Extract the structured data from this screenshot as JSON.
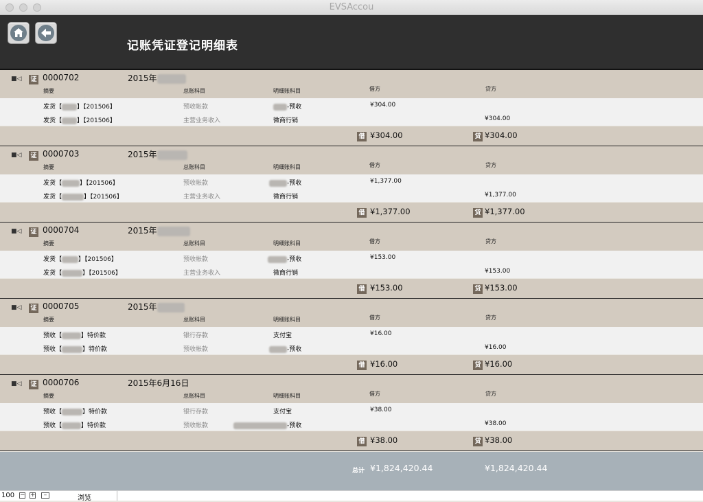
{
  "window": {
    "title": "EVSAccou"
  },
  "header": {
    "title": "记账凭证登记明细表"
  },
  "columns": {
    "summary": "摘要",
    "general": "总账科目",
    "detail": "明细账科目",
    "debit": "借方",
    "credit": "贷方"
  },
  "badges": {
    "voucher": "证",
    "debit": "借",
    "credit": "贷"
  },
  "vouchers": [
    {
      "no": "0000702",
      "date": "2015年",
      "rows": [
        {
          "s1": "发货【",
          "s2": "】【201506】",
          "general": "预收帐款",
          "detail_post": "-预收",
          "debit": "¥304.00",
          "credit": ""
        },
        {
          "s1": "发货【",
          "s2": "】【201506】",
          "general": "主营业务收入",
          "detail": "微商行销",
          "debit": "",
          "credit": "¥304.00"
        }
      ],
      "total_debit": "¥304.00",
      "total_credit": "¥304.00"
    },
    {
      "no": "0000703",
      "date": "2015年",
      "rows": [
        {
          "s1": "发货【",
          "s2": "】【201506】",
          "general": "预收帐款",
          "detail_post": "-预收",
          "debit": "¥1,377.00",
          "credit": ""
        },
        {
          "s1": "发货【",
          "s2": "】【201506】",
          "general": "主营业务收入",
          "detail": "微商行销",
          "debit": "",
          "credit": "¥1,377.00"
        }
      ],
      "total_debit": "¥1,377.00",
      "total_credit": "¥1,377.00"
    },
    {
      "no": "0000704",
      "date": "2015年",
      "rows": [
        {
          "s1": "发货【",
          "s2": "】【201506】",
          "general": "预收帐款",
          "detail_post": "-预收",
          "debit": "¥153.00",
          "credit": ""
        },
        {
          "s1": "发货【",
          "s2": "】【201506】",
          "general": "主营业务收入",
          "detail": "微商行销",
          "debit": "",
          "credit": "¥153.00"
        }
      ],
      "total_debit": "¥153.00",
      "total_credit": "¥153.00"
    },
    {
      "no": "0000705",
      "date": "2015年",
      "rows": [
        {
          "s1": "预收【",
          "s2": "】特价款",
          "general": "银行存款",
          "detail": "支付宝",
          "debit": "¥16.00",
          "credit": ""
        },
        {
          "s1": "预收【",
          "s2": "】特价款",
          "general": "预收帐款",
          "detail_post": "-预收",
          "debit": "",
          "credit": "¥16.00"
        }
      ],
      "total_debit": "¥16.00",
      "total_credit": "¥16.00"
    },
    {
      "no": "0000706",
      "date": "2015年6月16日",
      "rows": [
        {
          "s1": "预收【",
          "s2": "】特价款",
          "general": "银行存款",
          "detail": "支付宝",
          "debit": "¥38.00",
          "credit": ""
        },
        {
          "s1": "预收【",
          "s2": "】特价款",
          "general": "预收帐款",
          "detail_post": "-预收",
          "debit": "",
          "credit": "¥38.00"
        }
      ],
      "total_debit": "¥38.00",
      "total_credit": "¥38.00"
    }
  ],
  "grand_total": {
    "label": "总计",
    "debit": "¥1,824,420.44",
    "credit": "¥1,824,420.44"
  },
  "statusbar": {
    "zoom": "100",
    "mode": "浏览"
  }
}
